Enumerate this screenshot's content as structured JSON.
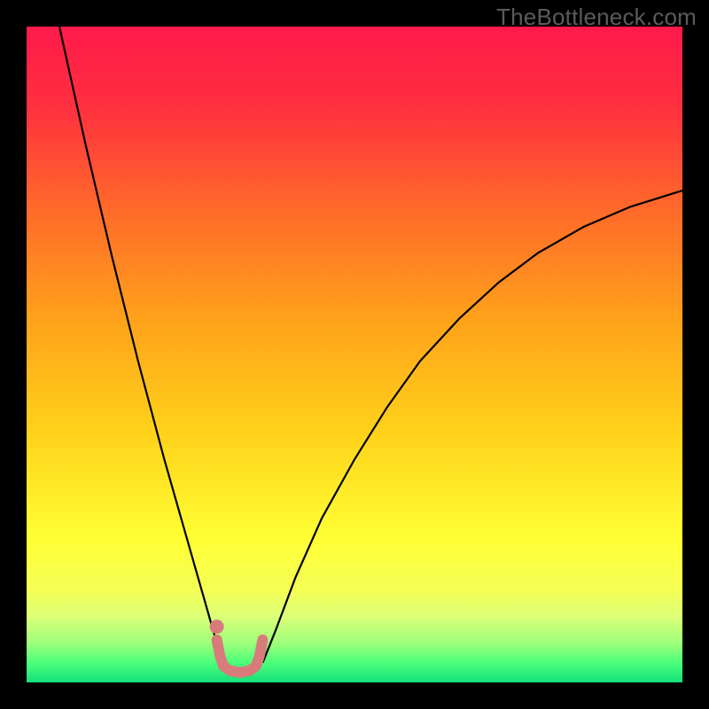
{
  "watermark": "TheBottleneck.com",
  "chart_data": {
    "type": "line",
    "title": "",
    "xlabel": "",
    "ylabel": "",
    "xlim": [
      0,
      100
    ],
    "ylim": [
      0,
      100
    ],
    "grid": false,
    "background_gradient": {
      "stops": [
        {
          "offset": 0.0,
          "color": "#ff1a4b"
        },
        {
          "offset": 0.12,
          "color": "#ff2f3f"
        },
        {
          "offset": 0.28,
          "color": "#ff6a2a"
        },
        {
          "offset": 0.45,
          "color": "#ffa31a"
        },
        {
          "offset": 0.62,
          "color": "#ffd21a"
        },
        {
          "offset": 0.78,
          "color": "#ffff33"
        },
        {
          "offset": 0.86,
          "color": "#f4ff55"
        },
        {
          "offset": 0.9,
          "color": "#dcff77"
        },
        {
          "offset": 0.94,
          "color": "#9eff7a"
        },
        {
          "offset": 0.97,
          "color": "#4cff7a"
        },
        {
          "offset": 1.0,
          "color": "#13e07a"
        }
      ]
    },
    "series": [
      {
        "name": "left-branch",
        "stroke": "#000000",
        "stroke_width": 2.2,
        "x": [
          5.0,
          7.0,
          9.0,
          11.0,
          13.0,
          15.0,
          17.0,
          19.0,
          21.0,
          23.0,
          25.0,
          27.0,
          28.0,
          29.0,
          30.0
        ],
        "y": [
          100.0,
          91.0,
          82.0,
          73.5,
          65.0,
          57.0,
          49.0,
          41.5,
          34.0,
          27.0,
          20.0,
          13.0,
          9.5,
          6.0,
          3.0
        ]
      },
      {
        "name": "right-branch",
        "stroke": "#000000",
        "stroke_width": 2.2,
        "x": [
          36.0,
          38.0,
          41.0,
          45.0,
          50.0,
          55.0,
          60.0,
          66.0,
          72.0,
          78.0,
          85.0,
          92.0,
          100.0
        ],
        "y": [
          3.0,
          8.0,
          16.0,
          25.0,
          34.0,
          42.0,
          49.0,
          55.5,
          61.0,
          65.5,
          69.5,
          72.5,
          75.0
        ]
      },
      {
        "name": "highlight-minimum",
        "stroke": "#d87b7b",
        "stroke_width": 12,
        "linecap": "round",
        "x": [
          29.0,
          29.5,
          30.0,
          31.0,
          32.5,
          34.0,
          35.0,
          35.5,
          36.0
        ],
        "y": [
          6.5,
          4.0,
          2.5,
          1.8,
          1.5,
          1.8,
          2.5,
          4.0,
          6.5
        ]
      },
      {
        "name": "highlight-dot",
        "type": "scatter",
        "stroke": "#d87b7b",
        "fill": "#d87b7b",
        "x": [
          29.0
        ],
        "y": [
          8.5
        ],
        "r": 8
      }
    ]
  }
}
